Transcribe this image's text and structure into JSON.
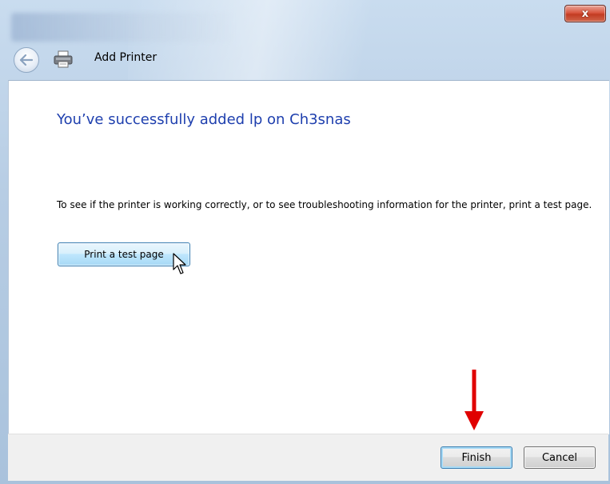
{
  "window": {
    "title": "Add Printer",
    "close_glyph": "x"
  },
  "content": {
    "heading": "You’ve successfully added lp on Ch3snas",
    "description": "To see if the printer is working correctly, or to see troubleshooting information for the printer, print a test page.",
    "test_page_button": "Print a test page"
  },
  "buttons": {
    "finish": "Finish",
    "cancel": "Cancel"
  },
  "icons": {
    "back": "back-arrow-icon",
    "printer": "printer-icon",
    "cursor": "mouse-cursor-icon",
    "annotation": "red-down-arrow-icon"
  },
  "colors": {
    "heading": "#1e3fae",
    "annotation_arrow": "#e00000",
    "close_button": "#c23b22"
  }
}
